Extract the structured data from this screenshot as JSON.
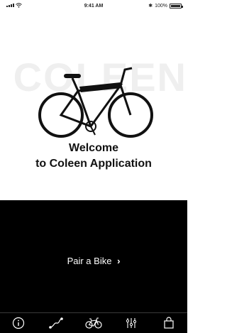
{
  "status_bar": {
    "time": "9:41 AM",
    "battery": "100%",
    "bluetooth": "✱"
  },
  "hero": {
    "brand_watermark": "COLEEN",
    "welcome_line1": "Welcome",
    "welcome_line2": "to Coleen Application"
  },
  "pair": {
    "label": "Pair a Bike",
    "chevron": "›"
  },
  "tab_bar": {
    "items": [
      {
        "icon": "info-icon"
      },
      {
        "icon": "route-icon"
      },
      {
        "icon": "bike-icon"
      },
      {
        "icon": "sliders-icon"
      },
      {
        "icon": "shopping-bag-icon"
      }
    ]
  },
  "colors": {
    "background_dark": "#000000",
    "background_light": "#ffffff",
    "text_dark": "#111111",
    "watermark": "#efefef"
  }
}
